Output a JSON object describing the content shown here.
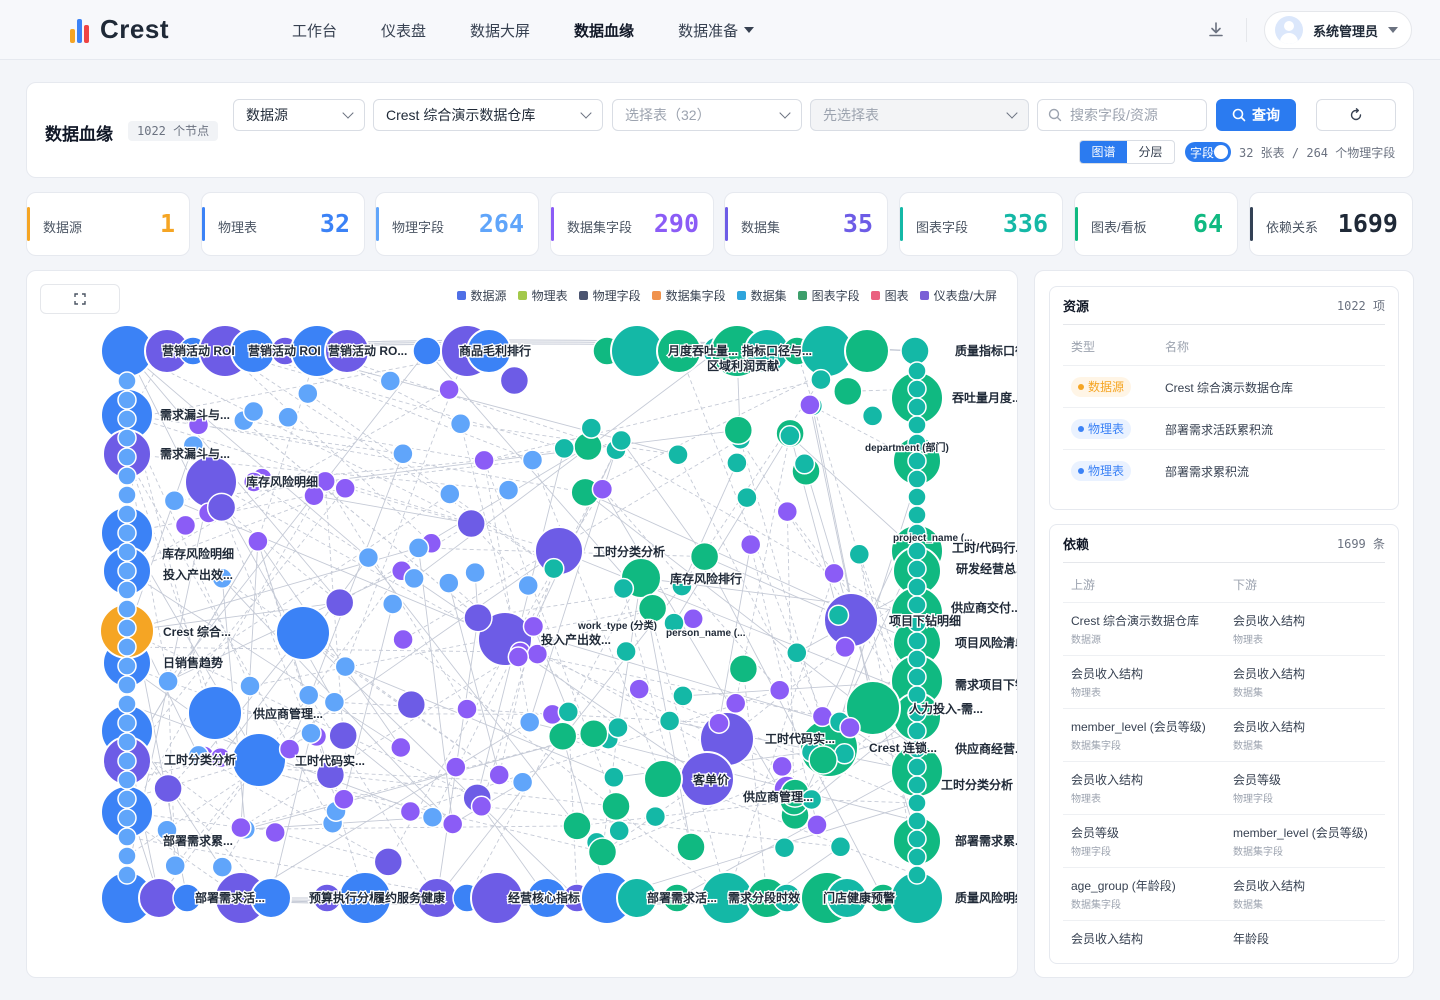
{
  "app": {
    "logo_text": "Crest"
  },
  "nav": {
    "items": [
      "工作台",
      "仪表盘",
      "数据大屏",
      "数据血缘",
      "数据准备"
    ],
    "active": "数据血缘"
  },
  "user": {
    "name": "系统管理员"
  },
  "page": {
    "title": "数据血缘",
    "node_count": "1022 个节点"
  },
  "filters": {
    "type_select": "数据源",
    "source_select": "Crest 综合演示数据仓库",
    "table_select_placeholder": "选择表（32）",
    "field_select_placeholder": "先选择表",
    "search_placeholder": "搜索字段/资源",
    "query_label": "查询",
    "view_graph": "图谱",
    "view_layer": "分层",
    "field_toggle_label": "字段",
    "field_stat": "32 张表 / 264 个物理字段"
  },
  "stats": [
    {
      "label": "数据源",
      "value": "1",
      "color": "#f5a524"
    },
    {
      "label": "物理表",
      "value": "32",
      "color": "#3b82f6"
    },
    {
      "label": "物理字段",
      "value": "264",
      "color": "#60a5fa"
    },
    {
      "label": "数据集字段",
      "value": "290",
      "color": "#8b5cf6"
    },
    {
      "label": "数据集",
      "value": "35",
      "color": "#6d5ce6"
    },
    {
      "label": "图表字段",
      "value": "336",
      "color": "#14b8a6"
    },
    {
      "label": "图表/看板",
      "value": "64",
      "color": "#10b981"
    },
    {
      "label": "依赖关系",
      "value": "1699",
      "color": "#334155"
    }
  ],
  "legend": [
    {
      "label": "数据源",
      "color": "#4f6fe6"
    },
    {
      "label": "物理表",
      "color": "#a3c94a"
    },
    {
      "label": "物理字段",
      "color": "#4b5470"
    },
    {
      "label": "数据集字段",
      "color": "#f0924d"
    },
    {
      "label": "数据集",
      "color": "#2fa5dc"
    },
    {
      "label": "图表字段",
      "color": "#3d9f6b"
    },
    {
      "label": "图表",
      "color": "#ea6080"
    },
    {
      "label": "仪表盘/大屏",
      "color": "#7a5fd6"
    }
  ],
  "graph": {
    "colors": {
      "table": "#3b82f6",
      "field": "#60a5fa",
      "dataset": "#6d5ce6",
      "dsfield": "#8b5cf6",
      "chart": "#10b981",
      "chartfield": "#14b8a6",
      "source": "#f5a524"
    },
    "labels": {
      "top": [
        "营销活动 ROI",
        "营销活动 ROI",
        "营销活动 RO...",
        "商品毛利排行",
        "月度吞吐量...",
        "指标口径与...",
        "区域利润贡献",
        "质量指标口径"
      ],
      "left": [
        "需求漏斗与...",
        "需求漏斗与...",
        "库存风险明细",
        "库存风险明细",
        "投入产出效...",
        "Crest 综合...",
        "日销售趋势",
        "供应商管理...",
        "工时分类分析",
        "工时代码实...",
        "部署需求累..."
      ],
      "bottom": [
        "部署需求活...",
        "预算执行分析",
        "履约服务健康",
        "经营核心指标",
        "部署需求活...",
        "需求分段时效",
        "门店健康预警",
        "质量风险明细"
      ],
      "right": [
        "吞吐量月度...",
        "department (部门)",
        "project_name (...",
        "工时/代码行...",
        "研发经营总...",
        "供应商交付...",
        "项目下钻明细",
        "项目风险清单",
        "需求项目下钻",
        "人力投入-需...",
        "供应商经营...",
        "Crest 连锁...",
        "工时分类分析",
        "部署需求累..."
      ],
      "center": [
        "工时分类分析",
        "库存风险排行",
        "work_type (分类)",
        "person_name (...",
        "投入产出效...",
        "项目下钻明细",
        "工时代码实...",
        "客单价",
        "供应商管理..."
      ]
    }
  },
  "resources": {
    "title": "资源",
    "count": "1022 项",
    "col_type": "类型",
    "col_name": "名称",
    "rows": [
      {
        "type": "数据源",
        "name": "Crest 综合演示数据仓库",
        "color": "#f5a524",
        "bg": "#fff5e6"
      },
      {
        "type": "物理表",
        "name": "部署需求活跃累积流",
        "color": "#3b82f6",
        "bg": "#eaf2ff"
      },
      {
        "type": "物理表",
        "name": "部署需求累积流",
        "color": "#3b82f6",
        "bg": "#eaf2ff"
      }
    ]
  },
  "dependencies": {
    "title": "依赖",
    "count": "1699 条",
    "col_up": "上游",
    "col_down": "下游",
    "rows": [
      {
        "up": "Crest 综合演示数据仓库",
        "up_type": "数据源",
        "down": "会员收入结构",
        "down_type": "物理表"
      },
      {
        "up": "会员收入结构",
        "up_type": "物理表",
        "down": "会员收入结构",
        "down_type": "数据集"
      },
      {
        "up": "member_level (会员等级)",
        "up_type": "数据集字段",
        "down": "会员收入结构",
        "down_type": "数据集"
      },
      {
        "up": "会员收入结构",
        "up_type": "物理表",
        "down": "会员等级",
        "down_type": "物理字段"
      },
      {
        "up": "会员等级",
        "up_type": "物理字段",
        "down": "member_level (会员等级)",
        "down_type": "数据集字段"
      },
      {
        "up": "age_group (年龄段)",
        "up_type": "数据集字段",
        "down": "会员收入结构",
        "down_type": "数据集"
      },
      {
        "up": "会员收入结构",
        "up_type": "",
        "down": "年龄段",
        "down_type": ""
      }
    ]
  }
}
